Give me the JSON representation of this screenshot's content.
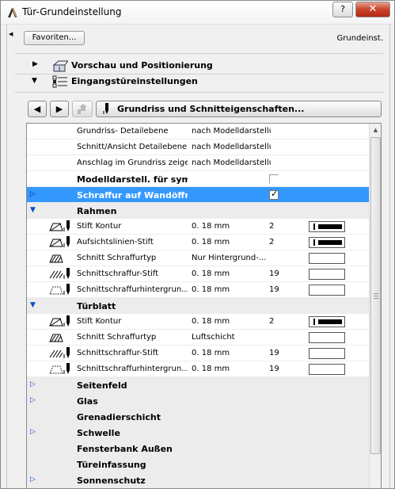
{
  "window": {
    "title": "Tür-Grundeinstellung",
    "help_label": "?",
    "close_label": "✕"
  },
  "header": {
    "favorites_label": "Favoriten...",
    "preset_name": "Grundeinst."
  },
  "sections": [
    {
      "label": "Vorschau und Positionierung",
      "expanded": false
    },
    {
      "label": "Eingangstüreinstellungen",
      "expanded": true
    }
  ],
  "nav": {
    "prev_label": "◀",
    "next_label": "▶",
    "up_label": "",
    "panel_title": "Grundriss und Schnitteigenschaften..."
  },
  "rows": [
    {
      "label": "Grundriss- Detailebene",
      "value": "nach Modelldarstellung"
    },
    {
      "label": "Schnitt/Ansicht Detailebene",
      "value": "nach Modelldarstellung"
    },
    {
      "label": "Anschlag im Grundriss zeigen",
      "value": "nach Modelldarstellung"
    },
    {
      "label": "Modelldarstell. für sym...",
      "checked": false
    },
    {
      "label": "Schraffur auf Wandöffnung",
      "checked": true
    },
    {
      "label": "Rahmen"
    },
    {
      "label": "Stift Kontur",
      "value": "0. 18 mm",
      "num": "2"
    },
    {
      "label": "Aufsichtslinien-Stift",
      "value": "0. 18 mm",
      "num": "2"
    },
    {
      "label": "Schnitt Schraffurtyp",
      "value": "Nur Hintergrund-..."
    },
    {
      "label": "Schnittschraffur-Stift",
      "value": "0. 18 mm",
      "num": "19"
    },
    {
      "label": "Schnittschraffurhintergrun...",
      "value": "0. 18 mm",
      "num": "19"
    },
    {
      "label": "Türblatt"
    },
    {
      "label": "Stift Kontur",
      "value": "0. 18 mm",
      "num": "2"
    },
    {
      "label": "Schnitt Schraffurtyp",
      "value": "Luftschicht"
    },
    {
      "label": "Schnittschraffur-Stift",
      "value": "0. 18 mm",
      "num": "19"
    },
    {
      "label": "Schnittschraffurhintergrun...",
      "value": "0. 18 mm",
      "num": "19"
    },
    {
      "label": "Seitenfeld"
    },
    {
      "label": "Glas"
    },
    {
      "label": "Grenadierschicht"
    },
    {
      "label": "Schwelle"
    },
    {
      "label": "Fensterbank Außen"
    },
    {
      "label": "Türeinfassung"
    },
    {
      "label": "Sonnenschutz"
    }
  ],
  "colors": {
    "selection": "#3399ff",
    "group_row": "#ececec",
    "tree_arrow": "#0050c8"
  }
}
